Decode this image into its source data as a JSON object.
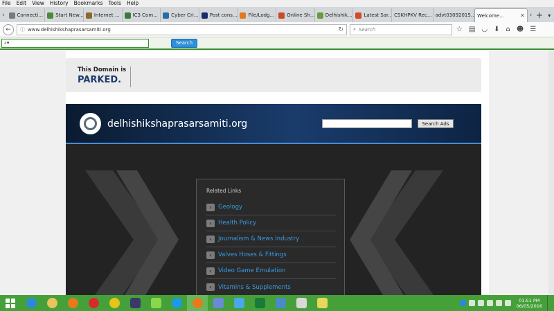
{
  "menu": [
    "File",
    "Edit",
    "View",
    "History",
    "Bookmarks",
    "Tools",
    "Help"
  ],
  "tabs": [
    {
      "label": "Connecti...",
      "color": "#7a7a7a"
    },
    {
      "label": "Start New...",
      "color": "#4a8a3a"
    },
    {
      "label": "Internet ...",
      "color": "#8a6a2a"
    },
    {
      "label": "IC3 Com...",
      "color": "#3a7a3a"
    },
    {
      "label": "Cyber Cri...",
      "color": "#2a6aa8"
    },
    {
      "label": "Post cons...",
      "color": "#1a2a6a"
    },
    {
      "label": "File/Lodg...",
      "color": "#e07a1a"
    },
    {
      "label": "Online Sh...",
      "color": "#c84a2a"
    },
    {
      "label": "Delhishik...",
      "color": "#6a9a3a"
    },
    {
      "label": "Latest Sar...",
      "color": "#d04a2a"
    },
    {
      "label": "CSKHPKV Rec...",
      "color": "#888888"
    },
    {
      "label": "advt03092015...",
      "color": "#888888"
    }
  ],
  "active_tab": {
    "label": "Welcome..."
  },
  "url": "www.delhishikshaprasarsamiti.org",
  "search_placeholder": "Search",
  "find": {
    "value": "",
    "button": "Search"
  },
  "parked": {
    "line1": "This Domain is",
    "line2": "PARKED."
  },
  "site": {
    "domain": "delhishikshaprasarsamiti.org",
    "ads_button": "Search Ads"
  },
  "related": {
    "title": "Related Links",
    "links": [
      "Geology",
      "Health Policy",
      "Journalism & News Industry",
      "Valves Hoses & Fittings",
      "Video Game Emulation",
      "Vitamins & Supplements"
    ]
  },
  "taskbar": {
    "apps": [
      {
        "name": "internet-explorer-icon",
        "color": "#2a8ad8"
      },
      {
        "name": "file-explorer-icon",
        "color": "#e8c45a"
      },
      {
        "name": "firefox-icon",
        "color": "#e87a1a"
      },
      {
        "name": "opera-icon",
        "color": "#d82a2a"
      },
      {
        "name": "chrome-icon",
        "color": "#e8c41a"
      },
      {
        "name": "app-icon-1",
        "color": "#3a3a6a"
      },
      {
        "name": "app-icon-2",
        "color": "#8ad84a"
      },
      {
        "name": "skype-icon",
        "color": "#1a9ae8"
      },
      {
        "name": "firefox-active-icon",
        "color": "#e87a1a"
      },
      {
        "name": "app-icon-3",
        "color": "#6a8ad8"
      },
      {
        "name": "app-icon-4",
        "color": "#4aa8e8"
      },
      {
        "name": "excel-icon",
        "color": "#1a7a3a"
      },
      {
        "name": "app-icon-5",
        "color": "#4a8ac8"
      },
      {
        "name": "paint-icon",
        "color": "#d8d8d8"
      },
      {
        "name": "app-icon-6",
        "color": "#e8d85a"
      }
    ],
    "time": "01:51 PM",
    "date": "06/05/2016"
  }
}
